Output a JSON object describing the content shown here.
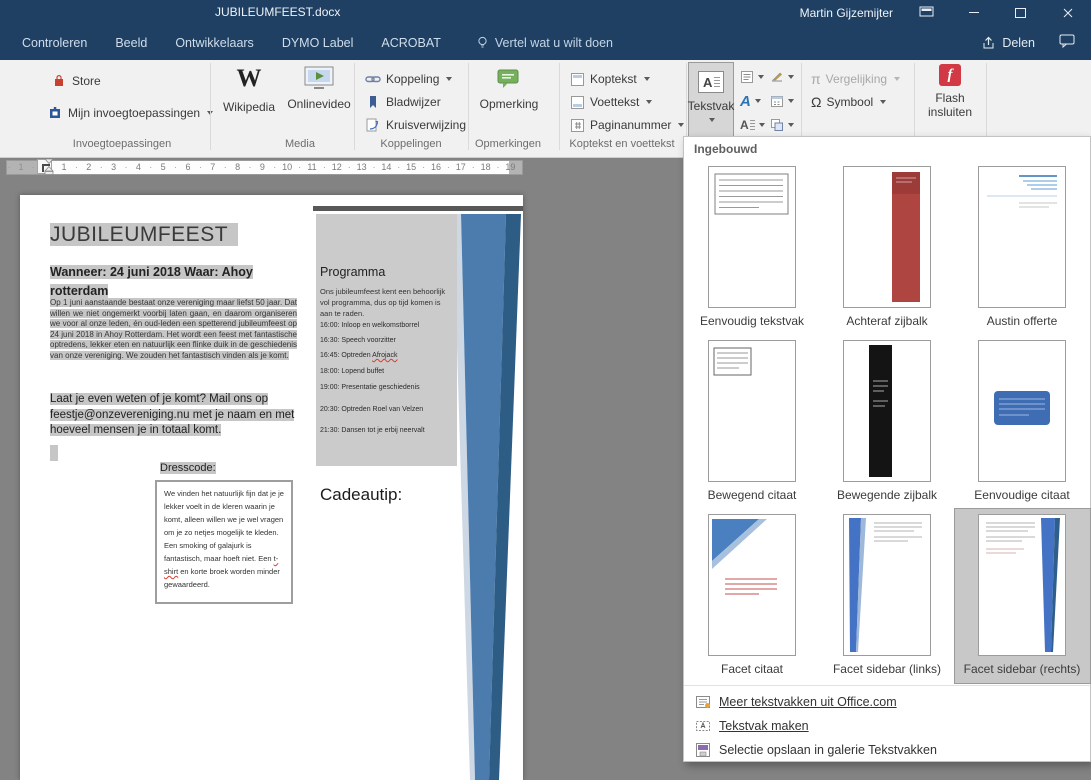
{
  "titlebar": {
    "title": "JUBILEUMFEEST.docx",
    "user": "Martin Gijzemijter"
  },
  "tabs": [
    "Controleren",
    "Beeld",
    "Ontwikkelaars",
    "DYMO Label",
    "ACROBAT"
  ],
  "tellme": {
    "label": "Vertel wat u wilt doen"
  },
  "share": {
    "label": "Delen"
  },
  "ribbon": {
    "invoegtoepassingen": {
      "label": "Invoegtoepassingen",
      "store": "Store",
      "my_addins": "Mijn invoegtoepassingen"
    },
    "media": {
      "label": "Media",
      "wikipedia": "Wikipedia",
      "onlinevideo": "Onlinevideo"
    },
    "koppelingen": {
      "label": "Koppelingen",
      "koppeling": "Koppeling",
      "bladwijzer": "Bladwijzer",
      "kruisverwijzing": "Kruisverwijzing"
    },
    "opmerkingen": {
      "label": "Opmerkingen",
      "opmerking": "Opmerking"
    },
    "koptekst_voettekst": {
      "label": "Koptekst en voettekst",
      "koptekst": "Koptekst",
      "voettekst": "Voettekst",
      "paginanummer": "Paginanummer"
    },
    "tekst": {
      "tekstvak": "Tekstvak"
    },
    "symbolen": {
      "vergelijking": "Vergelijking",
      "symbool": "Symbool"
    },
    "flash": {
      "line1": "Flash",
      "line2": "insluiten"
    }
  },
  "icons": {
    "wikipedia_w": "W",
    "equation_pi": "π",
    "symbol_omega": "Ω",
    "textbox_a": "A",
    "wordart_a": "A",
    "dropcap_a": "A",
    "flash_f": "f"
  },
  "dropdown": {
    "header": "Ingebouwd",
    "items": [
      {
        "label": "Eenvoudig tekstvak"
      },
      {
        "label": "Achteraf zijbalk"
      },
      {
        "label": "Austin offerte"
      },
      {
        "label": "Bewegend citaat"
      },
      {
        "label": "Bewegende zijbalk"
      },
      {
        "label": "Eenvoudige citaat"
      },
      {
        "label": "Facet citaat"
      },
      {
        "label": "Facet sidebar (links)"
      },
      {
        "label": "Facet sidebar (rechts)",
        "selected": true
      }
    ],
    "menu": [
      "Meer tekstvakken uit Office.com",
      "Tekstvak maken",
      "Selectie opslaan in galerie Tekstvakken"
    ]
  },
  "ruler": {
    "dot": "·",
    "numbers": [
      "1",
      "1",
      "2",
      "3",
      "4",
      "5",
      "6",
      "7",
      "8",
      "9",
      "10",
      "11",
      "12",
      "13",
      "14",
      "15",
      "16",
      "17",
      "18",
      "19"
    ]
  },
  "document": {
    "title": "JUBILEUMFEEST",
    "when_where": "Wanneer: 24 juni 2018 Waar: Ahoy rotterdam",
    "intro": "Op 1 juni aanstaande bestaat onze vereniging maar liefst 50 jaar. Dat willen we niet ongemerkt voorbij laten gaan, en daarom organiseren we voor al onze leden, én oud-leden een spetterend jubileumfeest op 24 juni 2018 in Ahoy Rotterdam. Het wordt een feest met fantastische optredens, lekker eten en natuurlijk een flinke duik in de geschiedenis van onze vereniging. We zouden het fantastisch vinden als je komt.",
    "rsvp": "Laat je even weten of je komt? Mail ons op feestje@onzevereniging.nu met je naam en met hoeveel mensen je in totaal komt.",
    "dresscode_label": "Dresscode:",
    "dresscode_text_1": "We vinden het natuurlijk fijn dat je je lekker voelt in de kleren waarin je komt, alleen willen we je wel vragen om je zo netjes mogelijk te kleden. Een smoking of galajurk is fantastisch, maar hoeft niet. Een ",
    "dresscode_spell": "t-shirt",
    "dresscode_text_2": " en korte broek worden minder gewaardeerd.",
    "sidebar": {
      "heading": "Programma",
      "intro": "Ons jubileumfeest kent een behoorlijk vol programma, dus op tijd komen is aan te raden.",
      "schedule": [
        {
          "text": "16:00: Inloop en welkomstborrel"
        },
        {
          "text": "16:30: Speech voorzitter"
        },
        {
          "text": "16:45: Optreden ",
          "spell": "Afrojack"
        },
        {
          "text": "18:00: Lopend buffet"
        },
        {
          "text": "19:00: Presentatie geschiedenis"
        },
        {
          "text": "20:30: Optreden Roel van Velzen"
        },
        {
          "text": "21:30: Dansen tot je erbij neervalt"
        }
      ],
      "gift_heading": "Cadeautip:"
    }
  }
}
